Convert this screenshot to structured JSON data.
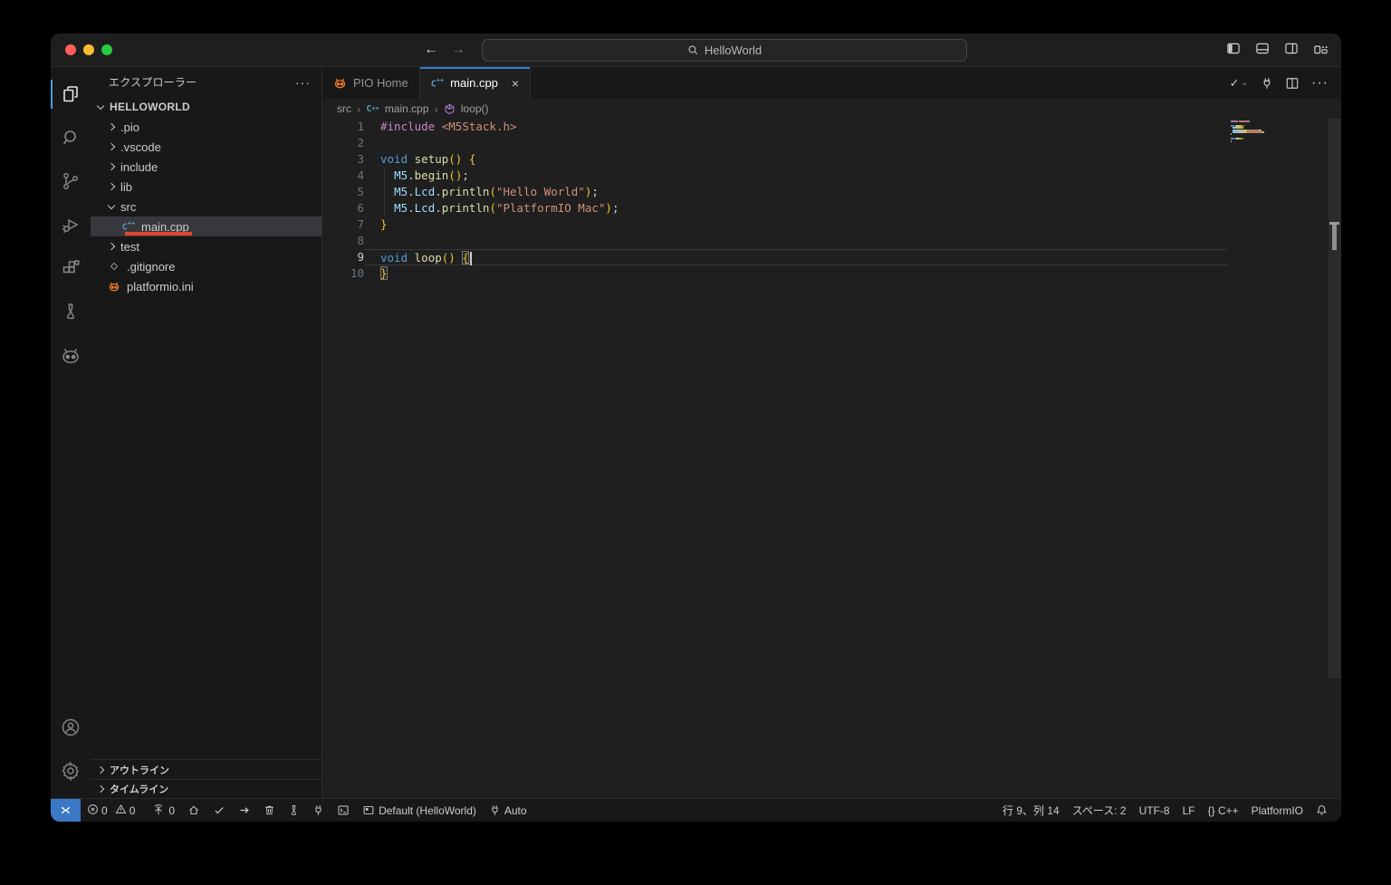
{
  "titlebar": {
    "command_center_text": "HelloWorld",
    "back_glyph": "←",
    "forward_glyph": "→"
  },
  "explorer": {
    "title": "エクスプローラー",
    "more_glyph": "···",
    "root": "HELLOWORLD",
    "items": [
      {
        "label": ".pio",
        "type": "folder",
        "depth": 1
      },
      {
        "label": ".vscode",
        "type": "folder",
        "depth": 1
      },
      {
        "label": "include",
        "type": "folder",
        "depth": 1
      },
      {
        "label": "lib",
        "type": "folder",
        "depth": 1
      },
      {
        "label": "src",
        "type": "folder",
        "depth": 1,
        "expanded": true
      },
      {
        "label": "main.cpp",
        "type": "file-cpp",
        "depth": 2,
        "selected": true,
        "underline": true
      },
      {
        "label": "test",
        "type": "folder",
        "depth": 1
      },
      {
        "label": ".gitignore",
        "type": "file-git",
        "depth": 1
      },
      {
        "label": "platformio.ini",
        "type": "file-pio",
        "depth": 1
      }
    ],
    "sections": [
      {
        "label": "アウトライン"
      },
      {
        "label": "タイムライン"
      }
    ]
  },
  "tabs": [
    {
      "label": "PIO Home",
      "icon": "platformio",
      "active": false
    },
    {
      "label": "main.cpp",
      "icon": "cpp",
      "active": true,
      "close_glyph": "×"
    }
  ],
  "tab_actions": {
    "check_glyph": "✓",
    "chevron_glyph": "⌄",
    "more_glyph": "···"
  },
  "breadcrumb": {
    "separator": "›",
    "items": [
      "src",
      "main.cpp",
      "loop()"
    ]
  },
  "editor": {
    "current_line": 9,
    "cursor_line": 9,
    "lines": [
      {
        "n": "1",
        "tokens": [
          {
            "c": "kw2",
            "t": "#include"
          },
          {
            "c": "pun",
            "t": " "
          },
          {
            "c": "str",
            "t": "<M5Stack.h>"
          }
        ]
      },
      {
        "n": "2",
        "tokens": []
      },
      {
        "n": "3",
        "tokens": [
          {
            "c": "kw",
            "t": "void"
          },
          {
            "c": "pun",
            "t": " "
          },
          {
            "c": "fn",
            "t": "setup"
          },
          {
            "c": "br",
            "t": "()"
          },
          {
            "c": "pun",
            "t": " "
          },
          {
            "c": "br",
            "t": "{"
          }
        ]
      },
      {
        "n": "4",
        "tokens": [
          {
            "c": "pun",
            "t": "  "
          },
          {
            "c": "var",
            "t": "M5"
          },
          {
            "c": "pun",
            "t": "."
          },
          {
            "c": "fn",
            "t": "begin"
          },
          {
            "c": "br",
            "t": "()"
          },
          {
            "c": "pun",
            "t": ";"
          }
        ]
      },
      {
        "n": "5",
        "tokens": [
          {
            "c": "pun",
            "t": "  "
          },
          {
            "c": "var",
            "t": "M5"
          },
          {
            "c": "pun",
            "t": "."
          },
          {
            "c": "var",
            "t": "Lcd"
          },
          {
            "c": "pun",
            "t": "."
          },
          {
            "c": "fn",
            "t": "println"
          },
          {
            "c": "br",
            "t": "("
          },
          {
            "c": "str",
            "t": "\"Hello World\""
          },
          {
            "c": "br",
            "t": ")"
          },
          {
            "c": "pun",
            "t": ";"
          }
        ]
      },
      {
        "n": "6",
        "tokens": [
          {
            "c": "pun",
            "t": "  "
          },
          {
            "c": "var",
            "t": "M5"
          },
          {
            "c": "pun",
            "t": "."
          },
          {
            "c": "var",
            "t": "Lcd"
          },
          {
            "c": "pun",
            "t": "."
          },
          {
            "c": "fn",
            "t": "println"
          },
          {
            "c": "br",
            "t": "("
          },
          {
            "c": "str",
            "t": "\"PlatformIO Mac\""
          },
          {
            "c": "br",
            "t": ")"
          },
          {
            "c": "pun",
            "t": ";"
          }
        ]
      },
      {
        "n": "7",
        "tokens": [
          {
            "c": "br",
            "t": "}"
          }
        ]
      },
      {
        "n": "8",
        "tokens": []
      },
      {
        "n": "9",
        "tokens": [
          {
            "c": "kw",
            "t": "void"
          },
          {
            "c": "pun",
            "t": " "
          },
          {
            "c": "fn",
            "t": "loop"
          },
          {
            "c": "br",
            "t": "()"
          },
          {
            "c": "pun",
            "t": " "
          },
          {
            "c": "brm",
            "t": "{"
          }
        ]
      },
      {
        "n": "10",
        "tokens": [
          {
            "c": "brm",
            "t": "}"
          }
        ]
      }
    ],
    "token_colors": {
      "kw": "#569cd6",
      "kw2": "#c586c0",
      "fn": "#dcdcaa",
      "var": "#9cdcfe",
      "str": "#ce9178",
      "pun": "#d4d4d4",
      "br": "#e9c62f",
      "brm": "#e9c62f"
    }
  },
  "status_bar": {
    "left": [
      {
        "name": "remote-indicator",
        "icon": "remote",
        "text": ""
      },
      {
        "name": "problems",
        "icon": "",
        "text": ""
      },
      {
        "name": "pio-remote",
        "icon": "antenna",
        "text": "0"
      },
      {
        "name": "pio-home",
        "icon": "home",
        "text": ""
      },
      {
        "name": "pio-build",
        "icon": "check",
        "text": ""
      },
      {
        "name": "pio-upload",
        "icon": "arrow",
        "text": ""
      },
      {
        "name": "pio-clean",
        "icon": "trash",
        "text": ""
      },
      {
        "name": "pio-test",
        "icon": "beaker",
        "text": ""
      },
      {
        "name": "pio-monitor",
        "icon": "plug",
        "text": ""
      },
      {
        "name": "pio-terminal",
        "icon": "terminal",
        "text": ""
      },
      {
        "name": "pio-env",
        "icon": "env",
        "text": "Default (HelloWorld)"
      },
      {
        "name": "pio-port",
        "icon": "plug",
        "text": "Auto"
      }
    ],
    "problems": {
      "errors": "0",
      "warnings": "0"
    },
    "right": [
      {
        "name": "cursor-position",
        "icon": "",
        "text": "行 9、列 14"
      },
      {
        "name": "indentation",
        "icon": "",
        "text": "スペース: 2"
      },
      {
        "name": "encoding",
        "icon": "",
        "text": "UTF-8"
      },
      {
        "name": "eol",
        "icon": "",
        "text": "LF"
      },
      {
        "name": "language-mode",
        "icon": "",
        "text": "{} C++"
      },
      {
        "name": "platformio",
        "icon": "",
        "text": "PlatformIO"
      },
      {
        "name": "notifications",
        "icon": "bell",
        "text": ""
      }
    ]
  },
  "colors": {
    "accent_blue": "#2f7fd6",
    "remote_blue": "#3b79c7",
    "annotation_red": "#e0472e",
    "pio_orange": "#f5822a",
    "cpp_blue": "#519aba"
  }
}
